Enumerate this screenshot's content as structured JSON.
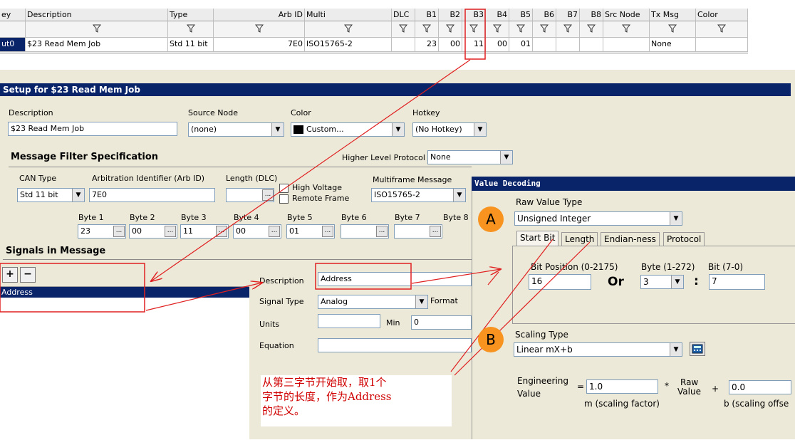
{
  "grid": {
    "headers": [
      "ey",
      "Description",
      "Type",
      "Arb ID",
      "Multi",
      "DLC",
      "B1",
      "B2",
      "B3",
      "B4",
      "B5",
      "B6",
      "B7",
      "B8",
      "Src Node",
      "Tx Msg",
      "Color"
    ],
    "row": [
      "ut0",
      "$23 Read Mem Job",
      "Std 11 bit",
      "7E0",
      "ISO15765-2",
      "",
      "23",
      "00",
      "11",
      "00",
      "01",
      "",
      "",
      "",
      "",
      "None",
      ""
    ]
  },
  "setup": {
    "title": "Setup for $23 Read Mem Job",
    "description_label": "Description",
    "description_value": "$23 Read Mem Job",
    "source_node_label": "Source Node",
    "source_node_value": "(none)",
    "color_label": "Color",
    "color_value": "Custom...",
    "hotkey_label": "Hotkey",
    "hotkey_value": "(No Hotkey)",
    "filter_heading": "Message Filter Specification",
    "hlp_label": "Higher Level Protocol",
    "hlp_value": "None",
    "can_type_label": "CAN Type",
    "can_type_value": "Std 11 bit",
    "arb_label": "Arbitration Identifier (Arb ID)",
    "arb_value": "7E0",
    "dlc_label": "Length (DLC)",
    "high_voltage_label": "High Voltage",
    "remote_frame_label": "Remote Frame",
    "multiframe_label": "Multiframe Message",
    "multiframe_value": "ISO15765-2",
    "bytes": [
      {
        "label": "Byte 1",
        "value": "23"
      },
      {
        "label": "Byte 2",
        "value": "00"
      },
      {
        "label": "Byte 3",
        "value": "11"
      },
      {
        "label": "Byte 4",
        "value": "00"
      },
      {
        "label": "Byte 5",
        "value": "01"
      },
      {
        "label": "Byte 6",
        "value": ""
      },
      {
        "label": "Byte 7",
        "value": ""
      },
      {
        "label": "Byte 8",
        "value": ""
      }
    ]
  },
  "signals": {
    "heading": "Signals in Message",
    "add_label": "+",
    "remove_label": "−",
    "items": [
      "Address"
    ],
    "description_label": "Description",
    "description_value": "Address",
    "signal_type_label": "Signal Type",
    "signal_type_value": "Analog",
    "format_label": "Format",
    "units_label": "Units",
    "min_label": "Min",
    "min_value": "0",
    "equation_label": "Equation"
  },
  "value_decoding": {
    "title": "Value Decoding",
    "raw_value_type_label": "Raw Value Type",
    "raw_value_type_value": "Unsigned Integer",
    "tabs": [
      "Start Bit",
      "Length",
      "Endian-ness",
      "Protocol"
    ],
    "bit_position_label": "Bit Position (0-2175)",
    "bit_position_value": "16",
    "or_label": "Or",
    "byte_label": "Byte (1-272)",
    "byte_value": "3",
    "colon": ":",
    "bit_label": "Bit (7-0)",
    "bit_value": "7",
    "scaling_type_label": "Scaling Type",
    "scaling_type_value": "Linear mX+b",
    "eng_value_label_1": "Engineering",
    "eng_value_label_2": "Value",
    "equals": "=",
    "m_value": "1.0",
    "times": "*",
    "raw_label_1": "Raw",
    "raw_label_2": "Value",
    "plus": "+",
    "b_value": "0.0",
    "m_caption": "m (scaling factor)",
    "b_caption": "b (scaling offse"
  },
  "annotations": {
    "circle_a": "A",
    "circle_b": "B",
    "note_line1": "从第三字节开始取，取1个",
    "note_line2": "字节的长度，作为Address",
    "note_line3": "的定义。",
    "accent": "#e02020"
  }
}
